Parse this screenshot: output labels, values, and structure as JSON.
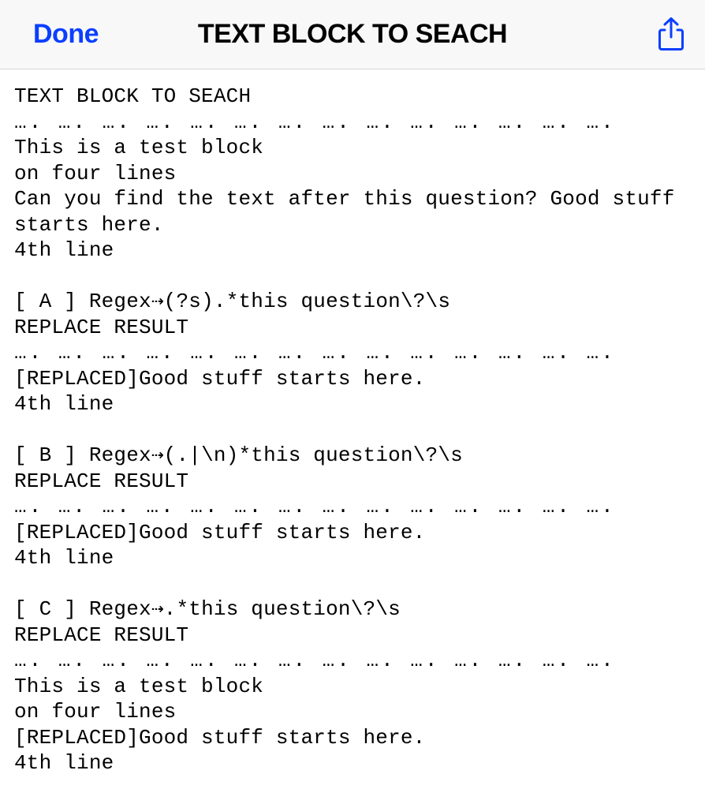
{
  "header": {
    "done_label": "Done",
    "title": "TEXT BLOCK TO SEACH"
  },
  "content": {
    "heading": "TEXT BLOCK TO SEACH",
    "sep": "…. …. …. …. …. …. …. …. …. …. …. …. …. ….",
    "l1": "This is a test block",
    "l2": "on four lines",
    "l3": "Can you find the text after this question? Good stuff starts here.",
    "l4": "4th line",
    "a_label": "[ A ] Regex⇢(?s).*this question\\?\\s",
    "a_header": "REPLACE RESULT",
    "a_r1": "[REPLACED]Good stuff starts here.",
    "a_r2": "4th line",
    "b_label": "[ B ] Regex⇢(.|\\n)*this question\\?\\s",
    "b_header": "REPLACE RESULT",
    "b_r1": "[REPLACED]Good stuff starts here.",
    "b_r2": "4th line",
    "c_label": "[ C ] Regex⇢.*this question\\?\\s",
    "c_header": "REPLACE RESULT",
    "c_r1": "This is a test block",
    "c_r2": "on four lines",
    "c_r3": "[REPLACED]Good stuff starts here.",
    "c_r4": "4th line"
  }
}
